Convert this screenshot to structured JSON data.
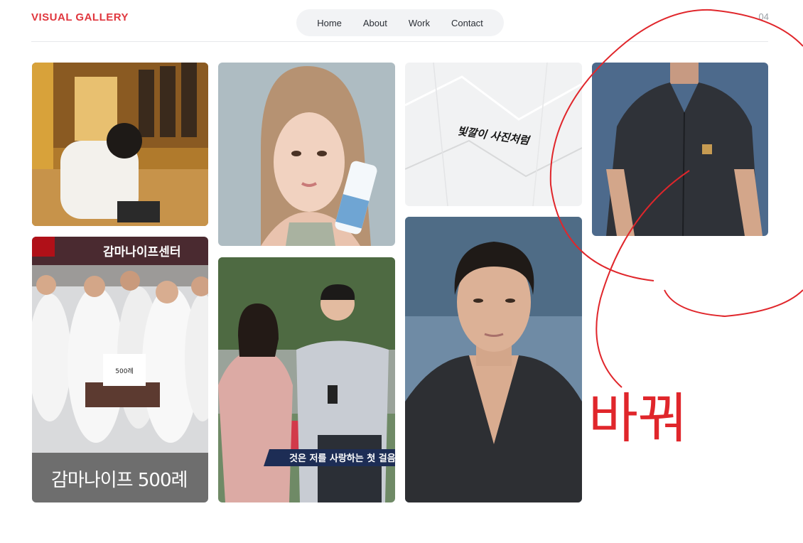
{
  "header": {
    "brand": "VISUAL GALLERY",
    "page_number": "04"
  },
  "nav": {
    "items": [
      "Home",
      "About",
      "Work",
      "Contact"
    ]
  },
  "gallery": {
    "calligraphy_text": "빛깔이 사진처럼",
    "doctors_banner_sign": "감마나이프센터",
    "doctors_caption": "감마나이프 500례",
    "cake_text": "500례",
    "interview_subtitle": "것은 저를 사랑하는 첫 걸음"
  },
  "annotation": {
    "handwritten_text": "바꿔",
    "color": "#e0262b"
  },
  "colors": {
    "accent": "#e0373e",
    "nav_bg": "#f2f3f5",
    "divider": "#e6e8eb"
  }
}
